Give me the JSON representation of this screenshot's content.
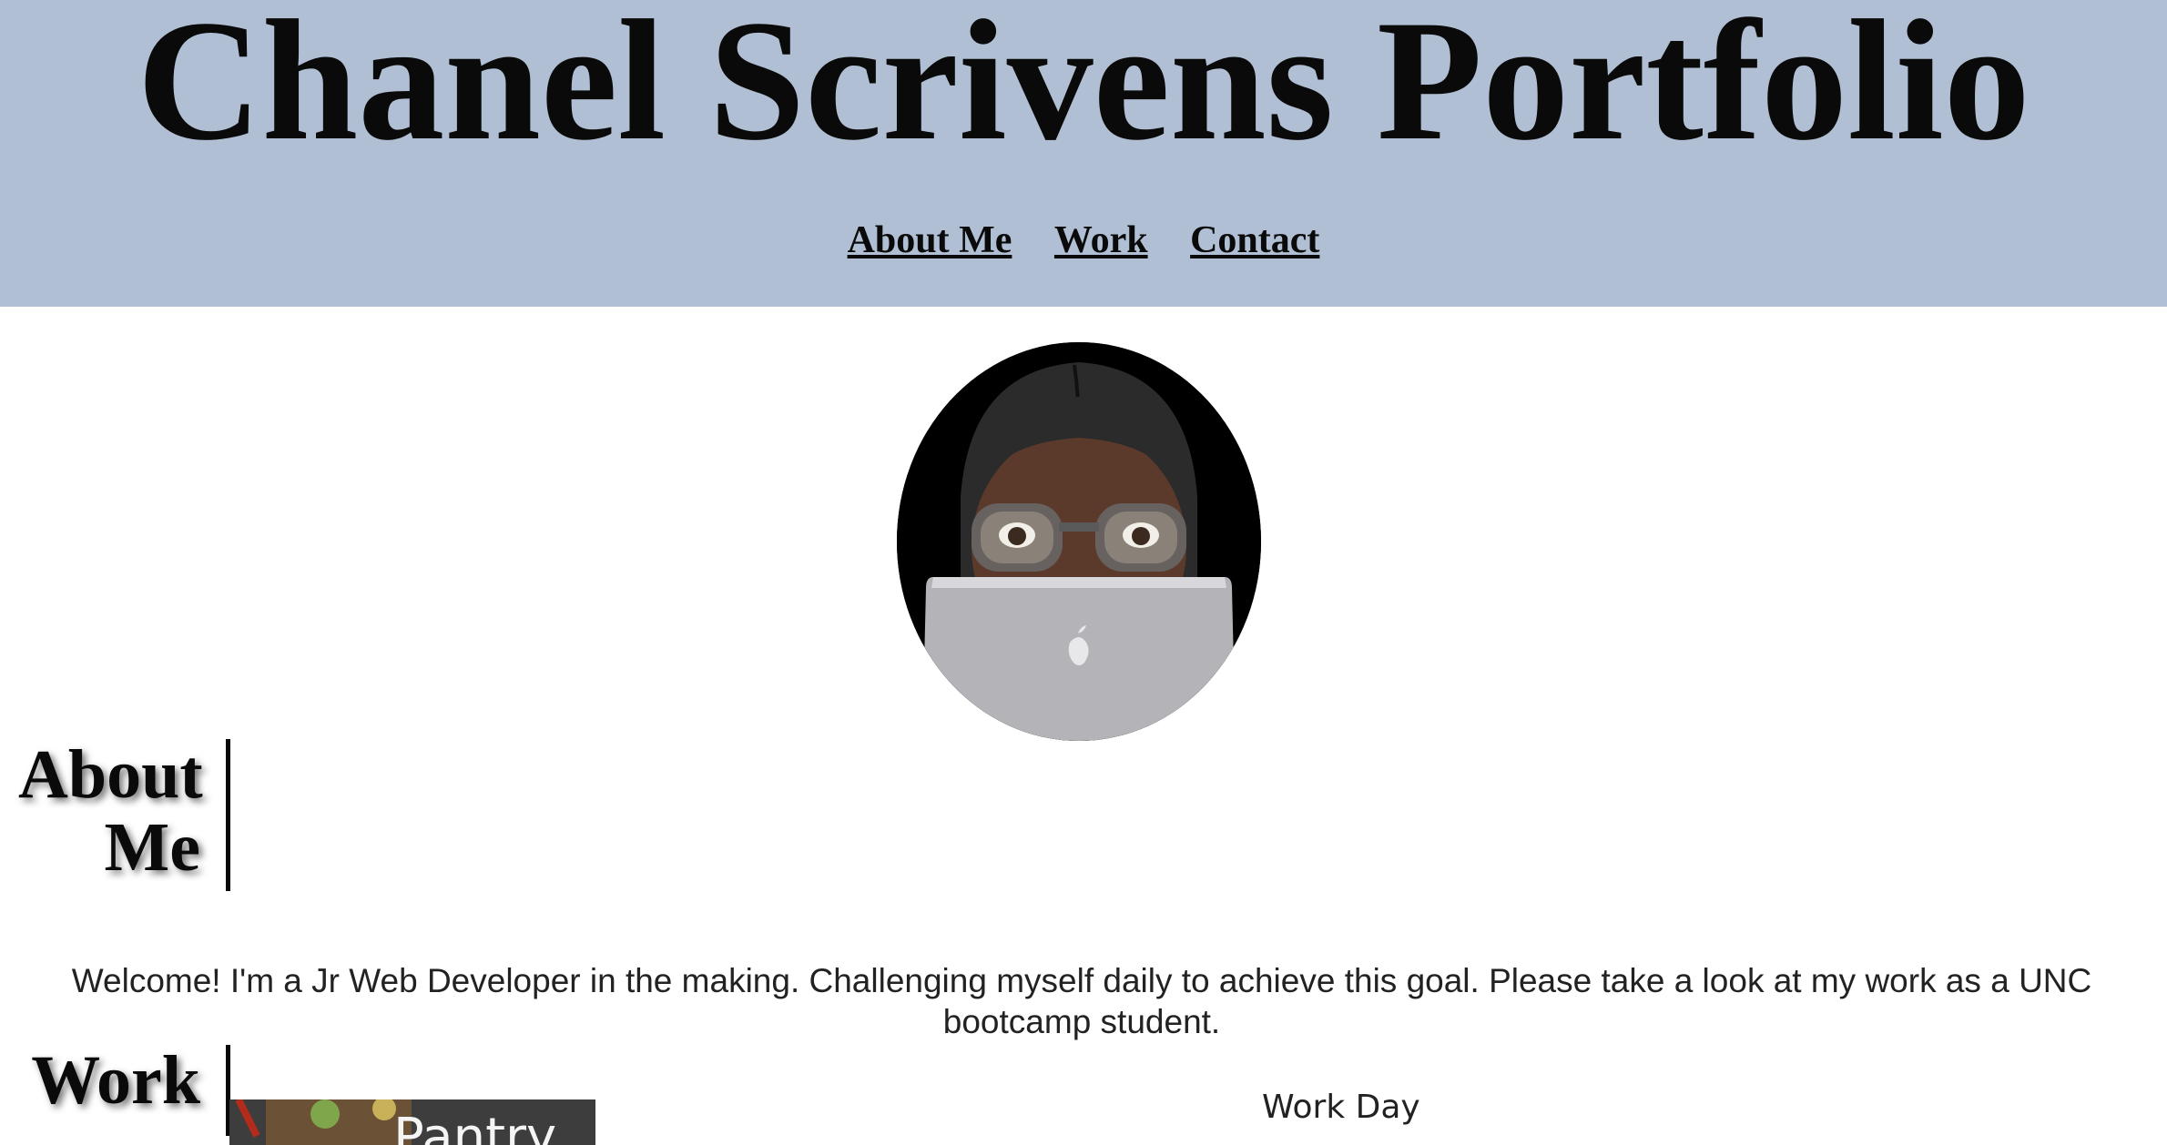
{
  "header": {
    "title": "Chanel Scrivens Portfolio",
    "nav": [
      "About Me",
      "Work",
      "Contact"
    ],
    "background": "#b0bfd3"
  },
  "avatar": {
    "icon": "memoji-avatar-icon"
  },
  "about": {
    "heading": "About Me",
    "text_line1": "Welcome! I'm a Jr Web Developer in the making. Challenging myself daily to achieve this goal. Please take a look at my work as a UNC",
    "text_line2": "bootcamp student."
  },
  "work": {
    "heading": "Work",
    "projects": [
      {
        "thumb_label": "Pantry"
      },
      {
        "title": "Work Day"
      }
    ]
  }
}
